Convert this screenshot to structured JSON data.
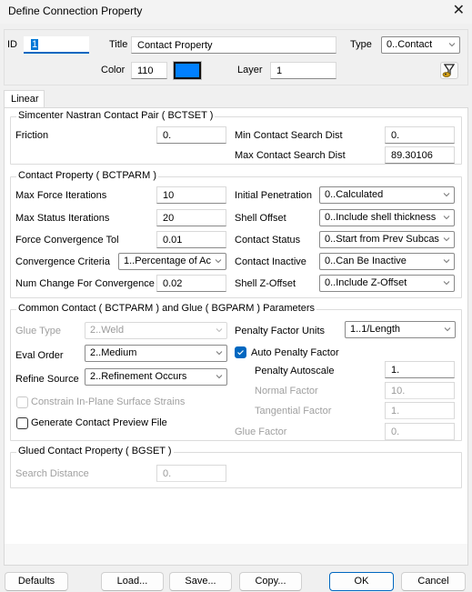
{
  "window": {
    "title": "Define Connection Property",
    "close_icon": "close-icon"
  },
  "header": {
    "id_label": "ID",
    "id_value": "1",
    "title_label": "Title",
    "title_value": "Contact Property",
    "type_label": "Type",
    "type_value": "0..Contact",
    "color_label": "Color",
    "color_value": "110",
    "color_swatch": "#0080ff",
    "layer_label": "Layer",
    "layer_value": "1",
    "filter_icon": "filter-icon"
  },
  "tabs": [
    {
      "label": "Linear",
      "active": true
    }
  ],
  "bctset": {
    "title": "Simcenter Nastran Contact Pair ( BCTSET )",
    "friction_label": "Friction",
    "friction_value": "0.",
    "min_search_label": "Min Contact Search Dist",
    "min_search_value": "0.",
    "max_search_label": "Max Contact Search Dist",
    "max_search_value": "89.30106"
  },
  "bctparm": {
    "title": "Contact Property ( BCTPARM )",
    "max_force_iter_label": "Max Force Iterations",
    "max_force_iter_value": "10",
    "max_status_iter_label": "Max Status Iterations",
    "max_status_iter_value": "20",
    "force_conv_tol_label": "Force Convergence Tol",
    "force_conv_tol_value": "0.01",
    "conv_criteria_label": "Convergence Criteria",
    "conv_criteria_value": "1..Percentage of Ac",
    "num_change_label": "Num Change For Convergence",
    "num_change_value": "0.02",
    "init_pen_label": "Initial Penetration",
    "init_pen_value": "0..Calculated",
    "shell_offset_label": "Shell Offset",
    "shell_offset_value": "0..Include shell thickness",
    "contact_status_label": "Contact Status",
    "contact_status_value": "0..Start from Prev Subcas",
    "contact_inactive_label": "Contact Inactive",
    "contact_inactive_value": "0..Can Be Inactive",
    "shell_zoffset_label": "Shell Z-Offset",
    "shell_zoffset_value": "0..Include Z-Offset"
  },
  "common": {
    "title": "Common Contact ( BCTPARM ) and Glue ( BGPARM ) Parameters",
    "glue_type_label": "Glue Type",
    "glue_type_value": "2..Weld",
    "eval_order_label": "Eval Order",
    "eval_order_value": "2..Medium",
    "refine_source_label": "Refine Source",
    "refine_source_value": "2..Refinement Occurs",
    "constrain_label": "Constrain In-Plane Surface Strains",
    "constrain_checked": false,
    "generate_label": "Generate Contact Preview File",
    "generate_checked": false,
    "penalty_units_label": "Penalty Factor Units",
    "penalty_units_value": "1..1/Length",
    "auto_penalty_label": "Auto Penalty Factor",
    "auto_penalty_checked": true,
    "penalty_autoscale_label": "Penalty Autoscale",
    "penalty_autoscale_value": "1.",
    "normal_factor_label": "Normal Factor",
    "normal_factor_value": "10.",
    "tangential_factor_label": "Tangential Factor",
    "tangential_factor_value": "1.",
    "glue_factor_label": "Glue Factor",
    "glue_factor_value": "0."
  },
  "bgset": {
    "title": "Glued Contact Property ( BGSET )",
    "search_distance_label": "Search Distance",
    "search_distance_value": "0."
  },
  "buttons": {
    "defaults": "Defaults",
    "load": "Load...",
    "save": "Save...",
    "copy": "Copy...",
    "ok": "OK",
    "cancel": "Cancel"
  }
}
